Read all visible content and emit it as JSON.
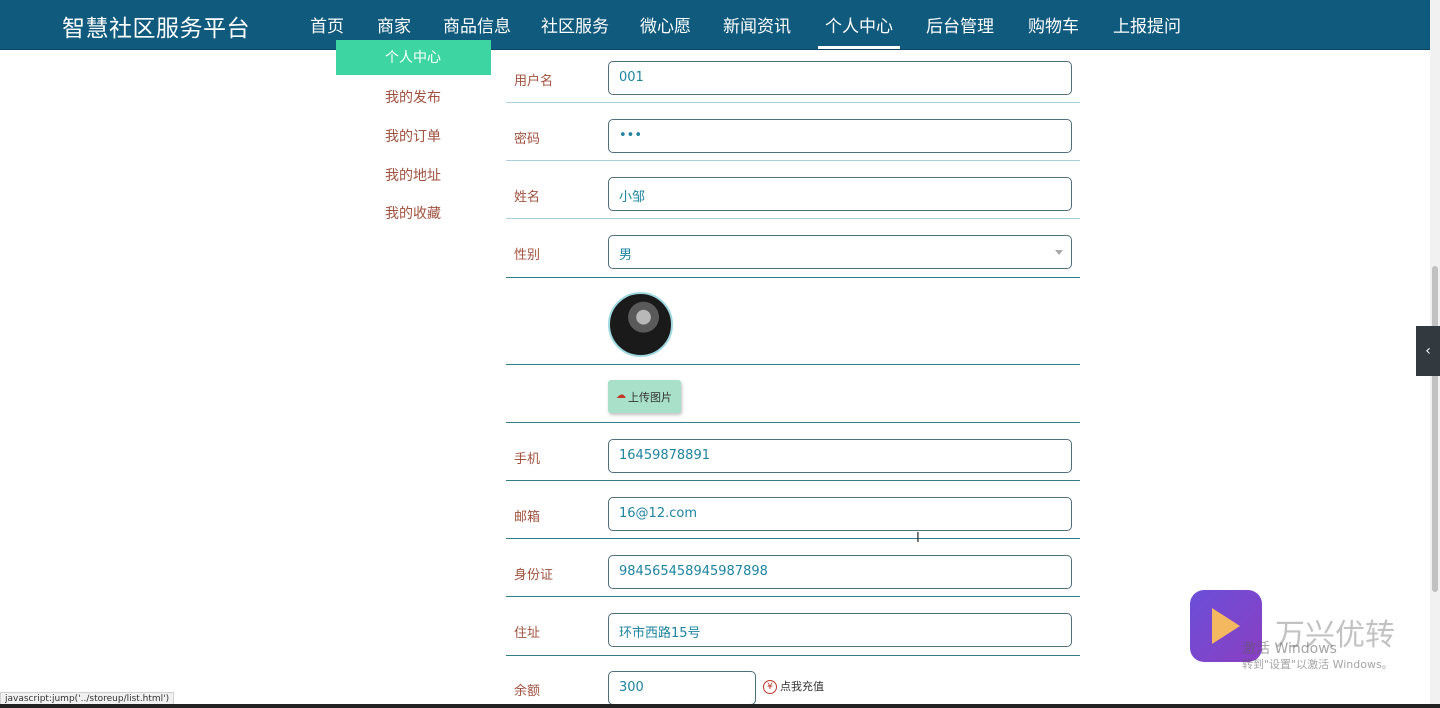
{
  "header": {
    "brand": "智慧社区服务平台",
    "nav": [
      {
        "label": "首页",
        "active": false
      },
      {
        "label": "商家",
        "active": false
      },
      {
        "label": "商品信息",
        "active": false
      },
      {
        "label": "社区服务",
        "active": false
      },
      {
        "label": "微心愿",
        "active": false
      },
      {
        "label": "新闻资讯",
        "active": false
      },
      {
        "label": "个人中心",
        "active": true
      },
      {
        "label": "后台管理",
        "active": false
      },
      {
        "label": "购物车",
        "active": false
      },
      {
        "label": "上报提问",
        "active": false
      }
    ]
  },
  "sidebar": {
    "active": "个人中心",
    "items": [
      "我的发布",
      "我的订单",
      "我的地址",
      "我的收藏"
    ]
  },
  "form": {
    "username": {
      "label": "用户名",
      "value": "001"
    },
    "password": {
      "label": "密码",
      "value": "•••"
    },
    "name": {
      "label": "姓名",
      "value": "小邹"
    },
    "gender": {
      "label": "性别",
      "value": "男"
    },
    "upload_label": "上传图片",
    "phone": {
      "label": "手机",
      "value": "16459878891"
    },
    "email": {
      "label": "邮箱",
      "value": "16@12.com"
    },
    "id_card": {
      "label": "身份证",
      "value": "984565458945987898"
    },
    "address": {
      "label": "住址",
      "value": "环市西路15号"
    },
    "balance": {
      "label": "余额",
      "value": "300"
    },
    "recharge_icon": "¥",
    "recharge_label": "点我充值"
  },
  "status_url": "javascript:jump('../storeup/list.html')",
  "watermark": {
    "brand": "万兴优转",
    "line1": "激活 Windows",
    "line2": "转到\"设置\"以激活 Windows。"
  },
  "icons": {
    "upload": "cloud-upload-icon",
    "recharge": "yen-icon",
    "side_toggle": "chevron-left-icon",
    "dropdown": "caret-down-icon"
  },
  "colors": {
    "header_bg": "#0f5a7d",
    "menu_active_bg": "#3dd6a3",
    "label_text": "#a0523f",
    "value_text": "#1e84a0",
    "upload_btn_bg": "#a8e0c9"
  }
}
